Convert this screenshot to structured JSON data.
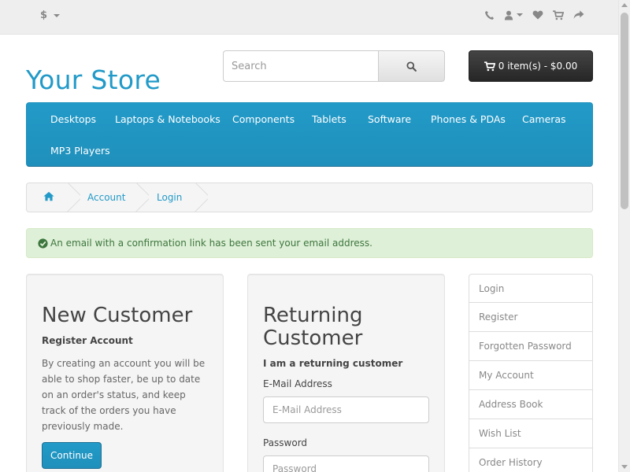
{
  "topbar": {
    "currency_label": "$",
    "icons": [
      "phone-icon",
      "user-icon",
      "heart-icon",
      "shopping-cart-icon",
      "share-icon"
    ]
  },
  "header": {
    "logo": "Your Store",
    "search_placeholder": "Search",
    "cart_label": "0 item(s) - $0.00"
  },
  "menu": {
    "items": [
      "Desktops",
      "Laptops & Notebooks",
      "Components",
      "Tablets",
      "Software",
      "Phones & PDAs",
      "Cameras",
      "MP3 Players"
    ]
  },
  "breadcrumb": {
    "items": [
      "Account",
      "Login"
    ]
  },
  "alert": {
    "message": "An email with a confirmation link has been sent your email address."
  },
  "new_customer": {
    "title": "New Customer",
    "subtitle": "Register Account",
    "text": "By creating an account you will be able to shop faster, be up to date on an order's status, and keep track of the orders you have previously made.",
    "button": "Continue"
  },
  "returning_customer": {
    "title": "Returning Customer",
    "subtitle": "I am a returning customer",
    "email_label": "E-Mail Address",
    "email_placeholder": "E-Mail Address",
    "password_label": "Password",
    "password_placeholder": "Password"
  },
  "account_links": [
    "Login",
    "Register",
    "Forgotten Password",
    "My Account",
    "Address Book",
    "Wish List",
    "Order History"
  ],
  "colors": {
    "accent": "#229ac8",
    "cart_button": "#363636",
    "alert_bg": "#dff0d8",
    "alert_text": "#3c763d"
  }
}
